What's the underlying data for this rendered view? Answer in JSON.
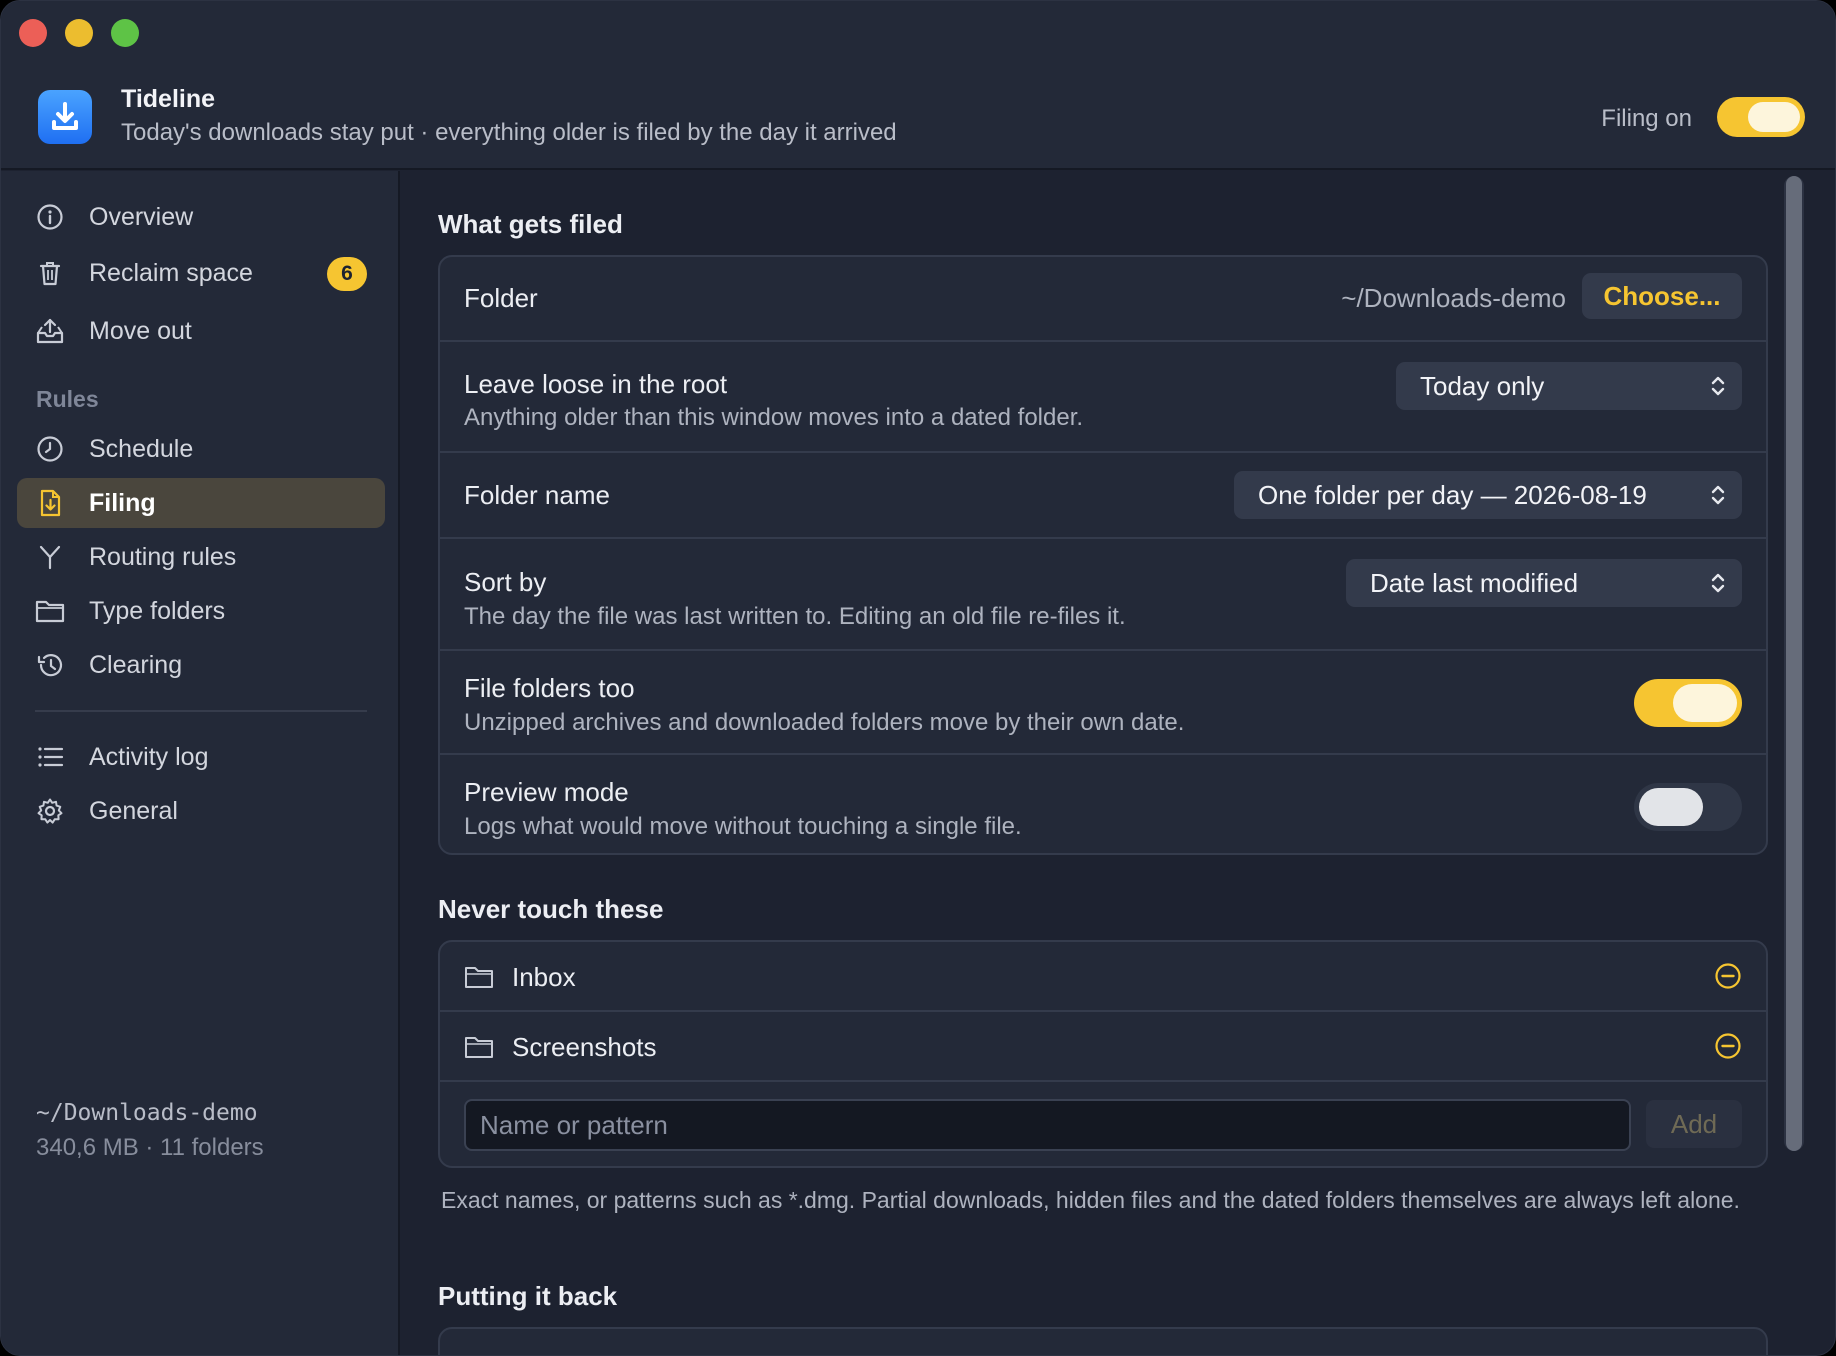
{
  "app": {
    "title": "Tideline",
    "subtitle": "Today's downloads stay put · everything older is filed by the day it arrived",
    "filing_label": "Filing on",
    "filing_on": true
  },
  "sidebar": {
    "items": [
      {
        "label": "Overview",
        "icon": "info-icon"
      },
      {
        "label": "Reclaim space",
        "icon": "trash-icon",
        "badge": "6"
      },
      {
        "label": "Move out",
        "icon": "tray-upload-icon"
      }
    ],
    "rules_heading": "Rules",
    "rules_items": [
      {
        "label": "Schedule",
        "icon": "clock-icon"
      },
      {
        "label": "Filing",
        "icon": "document-icon",
        "active": true
      },
      {
        "label": "Routing rules",
        "icon": "fork-icon"
      },
      {
        "label": "Type folders",
        "icon": "folder-icon"
      },
      {
        "label": "Clearing",
        "icon": "history-icon"
      }
    ],
    "bottom_items": [
      {
        "label": "Activity log",
        "icon": "list-icon"
      },
      {
        "label": "General",
        "icon": "gear-icon"
      }
    ],
    "footer": {
      "path": "~/Downloads-demo",
      "stats": "340,6 MB · 11 folders"
    }
  },
  "what_gets_filed": {
    "heading": "What gets filed",
    "folder": {
      "title": "Folder",
      "value": "~/Downloads-demo",
      "button": "Choose..."
    },
    "leave_loose": {
      "title": "Leave loose in the root",
      "desc": "Anything older than this window moves into a dated folder.",
      "value": "Today only"
    },
    "folder_name": {
      "title": "Folder name",
      "value": "One folder per day — 2026-08-19"
    },
    "sort_by": {
      "title": "Sort by",
      "desc": "The day the file was last written to. Editing an old file re-files it.",
      "value": "Date last modified"
    },
    "file_folders": {
      "title": "File folders too",
      "desc": "Unzipped archives and downloaded folders move by their own date.",
      "on": true
    },
    "preview_mode": {
      "title": "Preview mode",
      "desc": "Logs what would move without touching a single file.",
      "on": false
    }
  },
  "never_touch": {
    "heading": "Never touch these",
    "items": [
      "Inbox",
      "Screenshots"
    ],
    "input_placeholder": "Name or pattern",
    "add_button": "Add",
    "note": "Exact names, or patterns such as *.dmg. Partial downloads, hidden files and the dated folders themselves are always left alone."
  },
  "putting_back": {
    "heading": "Putting it back"
  },
  "colors": {
    "accent": "#f6c531",
    "background": "#1d2230",
    "sidebar": "#232938",
    "card": "#232938"
  }
}
